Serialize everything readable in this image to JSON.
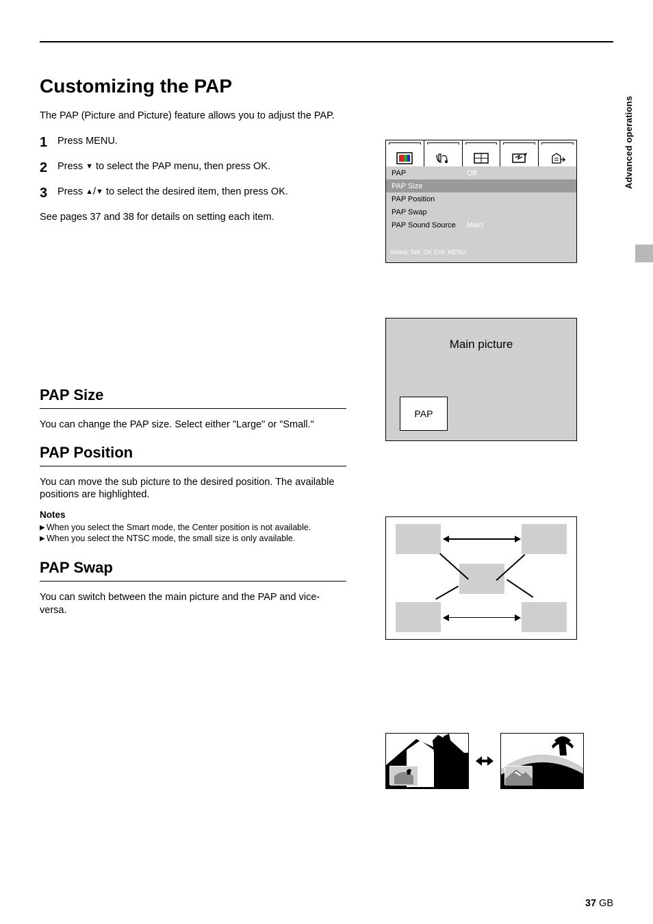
{
  "title": "Customizing the PAP",
  "intro": "The PAP (Picture and Picture) feature allows you to adjust the PAP.",
  "steps": [
    "Press MENU.",
    "Press b to select the PAP menu, then press OK.",
    "Press v/V to select the desired item, then press OK."
  ],
  "see_details": "See pages 37 and 38 for details on setting each item.",
  "menu": {
    "tab_names": [
      "picture-icon",
      "sound-icon",
      "screen-icon",
      "features-icon",
      "setup-icon"
    ],
    "rows": [
      {
        "label": "PAP",
        "val": "Off",
        "hl": false
      },
      {
        "label": "PAP Size",
        "val": "",
        "hl": true
      },
      {
        "label": "PAP Position",
        "val": "",
        "hl": false
      },
      {
        "label": "PAP Swap",
        "val": "",
        "hl": false
      },
      {
        "label": "PAP Sound Source",
        "val": "Main",
        "hl": false
      }
    ],
    "hint": "Select:      Set:  OK    Exit:   MENU"
  },
  "pos_demo": {
    "main_label": "Main picture",
    "sub_label": "PAP"
  },
  "sections": {
    "pap_size": {
      "title": "PAP Size",
      "body": "You can change the PAP size. Select either \"Large\" or \"Small.\""
    },
    "pap_position": {
      "title": "PAP Position",
      "body": "You can move the sub picture to the desired position. The available positions are highlighted.",
      "notes_title": "Notes",
      "notes": [
        "When you select the Smart mode, the Center position is not available.",
        "When you select the NTSC mode, the small size is only available."
      ]
    },
    "pap_swap": {
      "title": "PAP Swap",
      "body": "You can switch between the main picture and the PAP and vice-versa."
    }
  },
  "side_label": "Advanced operations",
  "pagenum": {
    "num": "37",
    "suffix": " GB"
  }
}
